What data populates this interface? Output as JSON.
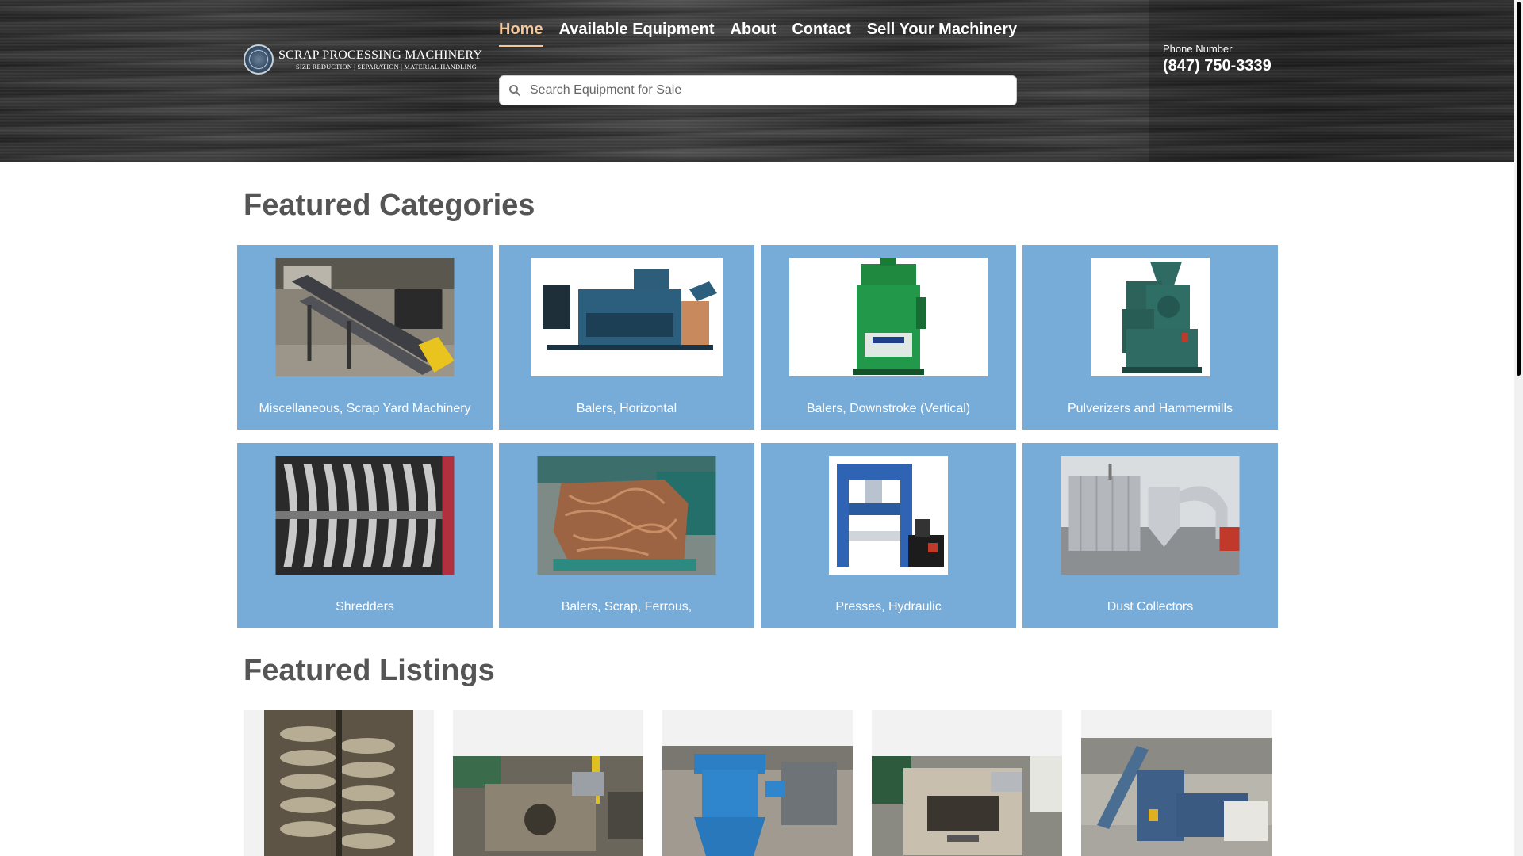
{
  "header": {
    "logo": {
      "name": "SCRAP PROCESSING MACHINERY",
      "tagline": "SIZE REDUCTION | SEPARATION | MATERIAL HANDLING"
    },
    "nav": [
      {
        "label": "Home",
        "active": true
      },
      {
        "label": "Available Equipment",
        "active": false
      },
      {
        "label": "About",
        "active": false
      },
      {
        "label": "Contact",
        "active": false
      },
      {
        "label": "Sell Your Machinery",
        "active": false
      }
    ],
    "search": {
      "placeholder": "Search Equipment for Sale",
      "value": ""
    },
    "phone": {
      "label": "Phone Number",
      "number": "(847) 750-3339"
    }
  },
  "featured_categories": {
    "title": "Featured Categories",
    "items": [
      {
        "label": "Miscellaneous, Scrap Yard Machinery",
        "icon": "conveyor-photo"
      },
      {
        "label": "Balers, Horizontal",
        "icon": "horizontal-baler-photo"
      },
      {
        "label": "Balers, Downstroke (Vertical)",
        "icon": "vertical-baler-photo"
      },
      {
        "label": "Pulverizers and Hammermills",
        "icon": "pulverizer-photo"
      },
      {
        "label": "Shredders",
        "icon": "shredder-blades-photo"
      },
      {
        "label": "Balers, Scrap, Ferrous,",
        "icon": "copper-bale-photo"
      },
      {
        "label": "Presses, Hydraulic",
        "icon": "hydraulic-press-photo"
      },
      {
        "label": "Dust Collectors",
        "icon": "dust-collector-photo"
      }
    ]
  },
  "featured_listings": {
    "title": "Featured Listings",
    "items": [
      {
        "icon": "shredder-rotor-photo"
      },
      {
        "icon": "granulator-photo"
      },
      {
        "icon": "blue-gearbox-photo"
      },
      {
        "icon": "cutter-machine-photo"
      },
      {
        "icon": "warehouse-baler-photo"
      }
    ]
  },
  "colors": {
    "accent_nav": "#f3c79a",
    "card_blue": "#78acd8",
    "heading": "#555555"
  }
}
